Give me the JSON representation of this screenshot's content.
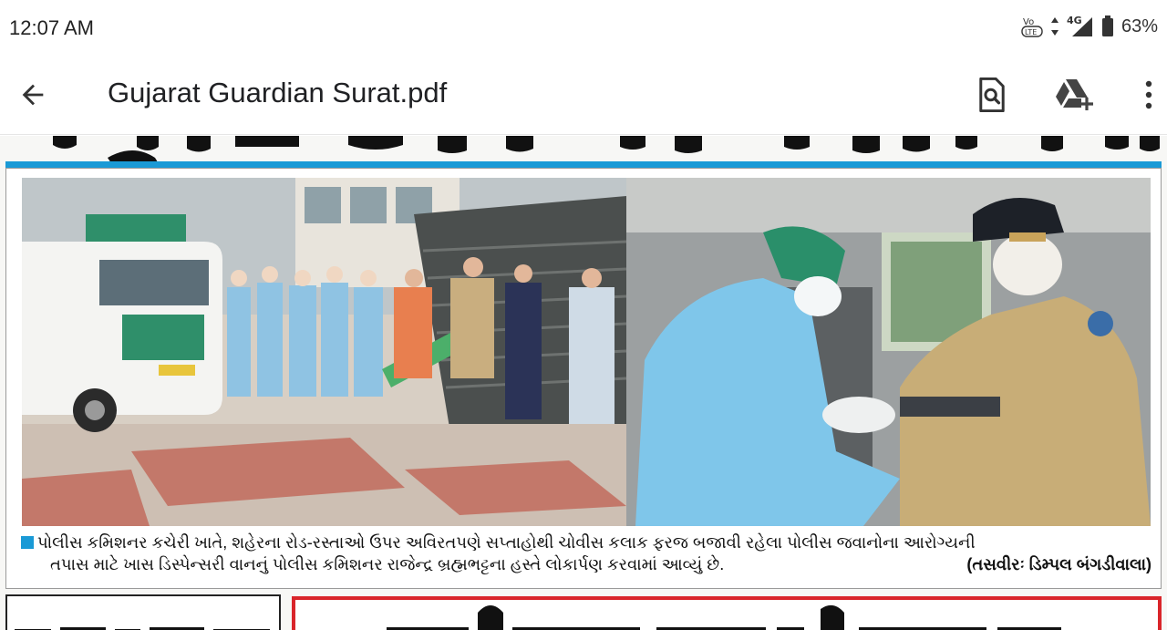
{
  "status": {
    "time": "12:07 AM",
    "battery": "63%",
    "network": "4G",
    "volte": "VoLTE"
  },
  "app_bar": {
    "title": "Gujarat Guardian Surat.pdf",
    "back_icon": "arrow-left-icon",
    "search_icon": "document-search-icon",
    "drive_icon": "add-to-drive-icon",
    "more_icon": "more-vert-icon"
  },
  "document": {
    "accent": "#1a9ad6",
    "caption": {
      "line1": "પોલીસ કમિશનર કચેરી ખાતે, શહેરના રોડ-રસ્તાઓ ઉપર અવિરતપણે સપ્તાહોથી ચોવીસ કલાક ફરજ બજાવી રહેલા પોલીસ જવાનોના આરોગ્યની",
      "line2": "તપાસ માટે ખાસ ડિસ્પેન્સરી વાનનું પોલીસ કમિશનર રાજેન્દ્ર બ્રહ્મભટ્ટના હસ્તે લોકાર્પણ કરવામાં આવ્યું છે.",
      "credit": "(તસવીરઃ ડિમ્પલ બંગડીવાલા)"
    }
  }
}
